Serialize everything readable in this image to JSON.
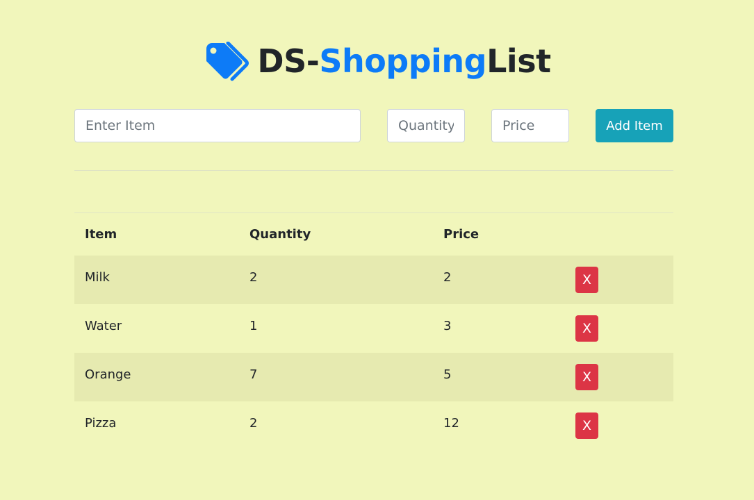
{
  "header": {
    "icon": "tags-icon",
    "title_part1": "DS-",
    "title_part2": "Shopping",
    "title_part3": "List",
    "accent_color": "#0d7bf7"
  },
  "form": {
    "item_placeholder": "Enter Item",
    "quantity_placeholder": "Quantity",
    "price_placeholder": "Price",
    "item_value": "",
    "quantity_value": "",
    "price_value": "",
    "add_button_label": "Add Item"
  },
  "table": {
    "headers": [
      "Item",
      "Quantity",
      "Price",
      ""
    ],
    "rows": [
      {
        "item": "Milk",
        "quantity": "2",
        "price": "2",
        "delete_label": "X"
      },
      {
        "item": "Water",
        "quantity": "1",
        "price": "3",
        "delete_label": "X"
      },
      {
        "item": "Orange",
        "quantity": "7",
        "price": "5",
        "delete_label": "X"
      },
      {
        "item": "Pizza",
        "quantity": "2",
        "price": "12",
        "delete_label": "X"
      }
    ]
  },
  "colors": {
    "background": "#f1f6bb",
    "add_button": "#17a2b8",
    "delete_button": "#dc3545",
    "stripe": "#e6eab0"
  }
}
